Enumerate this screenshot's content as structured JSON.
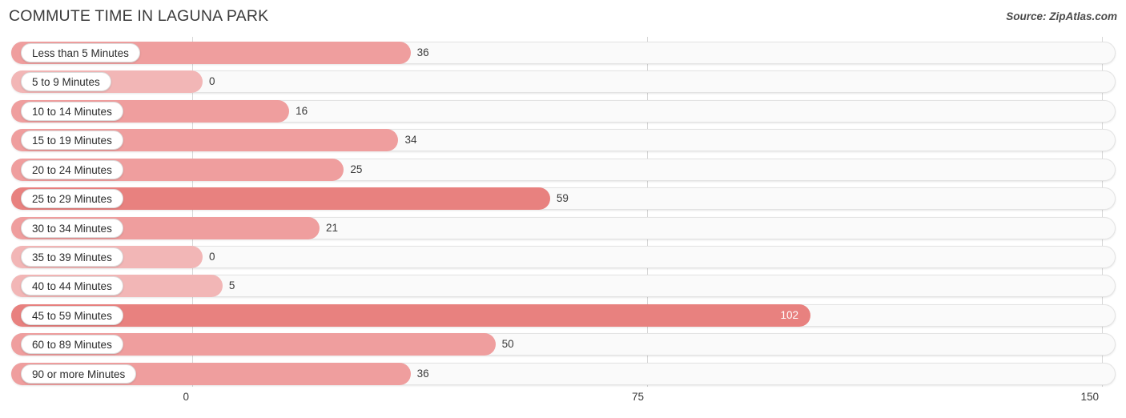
{
  "header": {
    "title": "COMMUTE TIME IN LAGUNA PARK",
    "source": "Source: ZipAtlas.com"
  },
  "colors": {
    "bar_light": "#f2b6b6",
    "bar_mid": "#ef9e9e",
    "bar_dark": "#e8817f",
    "track_fill": "#fafafa",
    "track_border": "#e3e3e3",
    "gridline": "#d8d8d8",
    "text": "#333333"
  },
  "chart_data": {
    "type": "bar",
    "orientation": "horizontal",
    "title": "COMMUTE TIME IN LAGUNA PARK",
    "xlabel": "",
    "ylabel": "",
    "xlim": [
      0,
      150
    ],
    "xticks": [
      0,
      75,
      150
    ],
    "xtick_labels": [
      "0",
      "75",
      "150"
    ],
    "grid": true,
    "legend": false,
    "categories": [
      "Less than 5 Minutes",
      "5 to 9 Minutes",
      "10 to 14 Minutes",
      "15 to 19 Minutes",
      "20 to 24 Minutes",
      "25 to 29 Minutes",
      "30 to 34 Minutes",
      "35 to 39 Minutes",
      "40 to 44 Minutes",
      "45 to 59 Minutes",
      "60 to 89 Minutes",
      "90 or more Minutes"
    ],
    "values": [
      36,
      0,
      16,
      34,
      25,
      59,
      21,
      0,
      5,
      102,
      50,
      36
    ],
    "value_labels": [
      "36",
      "0",
      "16",
      "34",
      "25",
      "59",
      "21",
      "0",
      "5",
      "102",
      "50",
      "36"
    ]
  },
  "rows": [
    {
      "label": "Less than 5 Minutes",
      "value": 36,
      "value_label": "36",
      "color": "#ef9e9e",
      "label_inside_bar": false
    },
    {
      "label": "5 to 9 Minutes",
      "value": 0,
      "value_label": "0",
      "color": "#f2b6b6",
      "label_inside_bar": false
    },
    {
      "label": "10 to 14 Minutes",
      "value": 16,
      "value_label": "16",
      "color": "#ef9e9e",
      "label_inside_bar": false
    },
    {
      "label": "15 to 19 Minutes",
      "value": 34,
      "value_label": "34",
      "color": "#ef9e9e",
      "label_inside_bar": false
    },
    {
      "label": "20 to 24 Minutes",
      "value": 25,
      "value_label": "25",
      "color": "#ef9e9e",
      "label_inside_bar": false
    },
    {
      "label": "25 to 29 Minutes",
      "value": 59,
      "value_label": "59",
      "color": "#e8817f",
      "label_inside_bar": false
    },
    {
      "label": "30 to 34 Minutes",
      "value": 21,
      "value_label": "21",
      "color": "#ef9e9e",
      "label_inside_bar": false
    },
    {
      "label": "35 to 39 Minutes",
      "value": 0,
      "value_label": "0",
      "color": "#f2b6b6",
      "label_inside_bar": false
    },
    {
      "label": "40 to 44 Minutes",
      "value": 5,
      "value_label": "5",
      "color": "#f2b6b6",
      "label_inside_bar": false
    },
    {
      "label": "45 to 59 Minutes",
      "value": 102,
      "value_label": "102",
      "color": "#e8817f",
      "label_inside_bar": true
    },
    {
      "label": "60 to 89 Minutes",
      "value": 50,
      "value_label": "50",
      "color": "#ef9e9e",
      "label_inside_bar": false
    },
    {
      "label": "90 or more Minutes",
      "value": 36,
      "value_label": "36",
      "color": "#ef9e9e",
      "label_inside_bar": false
    }
  ],
  "axis": {
    "ticks": [
      {
        "label": "0",
        "value": 0
      },
      {
        "label": "75",
        "value": 75
      },
      {
        "label": "150",
        "value": 150
      }
    ]
  }
}
